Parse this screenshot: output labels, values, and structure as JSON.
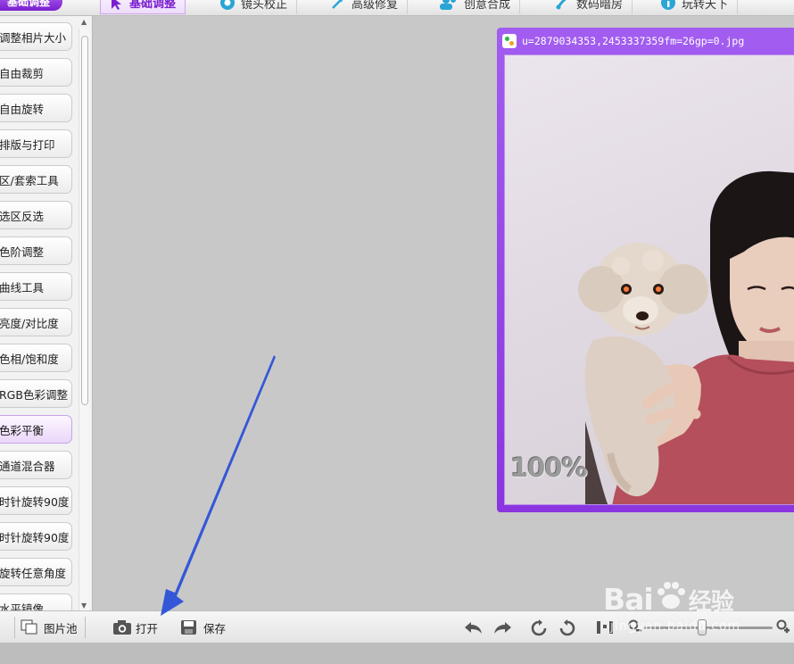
{
  "app": {
    "brand": "基础调整"
  },
  "topbar": {
    "tabs": [
      {
        "label": "基础调整",
        "icon": "cursor-icon"
      },
      {
        "label": "镜头校正",
        "icon": "aperture-icon"
      },
      {
        "label": "高级修复",
        "icon": "magic-wand-icon"
      },
      {
        "label": "创意合成",
        "icon": "people-icon"
      },
      {
        "label": "数码暗房",
        "icon": "brush-icon"
      },
      {
        "label": "玩转天下",
        "icon": "info-icon"
      }
    ]
  },
  "sidebar": {
    "items": [
      "调整相片大小",
      "自由裁剪",
      "自由旋转",
      "排版与打印",
      "区/套索工具",
      "选区反选",
      "色阶调整",
      "曲线工具",
      "亮度/对比度",
      "色相/饱和度",
      "RGB色彩调整",
      "色彩平衡",
      "通道混合器",
      "时针旋转90度",
      "时针旋转90度",
      "旋转任意角度",
      "水平镜像"
    ],
    "active_index": 11
  },
  "image_window": {
    "title": "u=2879034353,2453337359fm=26gp=0.jpg",
    "zoom_label": "100%"
  },
  "bottombar": {
    "picture_pool": "图片池",
    "open": "打开",
    "save": "保存",
    "zoom_level": 0.45
  },
  "watermark": {
    "text": "Bai",
    "text2": "经验",
    "sub": "jingyan.baidu.com"
  },
  "colors": {
    "accent": "#8a35e0",
    "arrow": "#3457d8"
  }
}
